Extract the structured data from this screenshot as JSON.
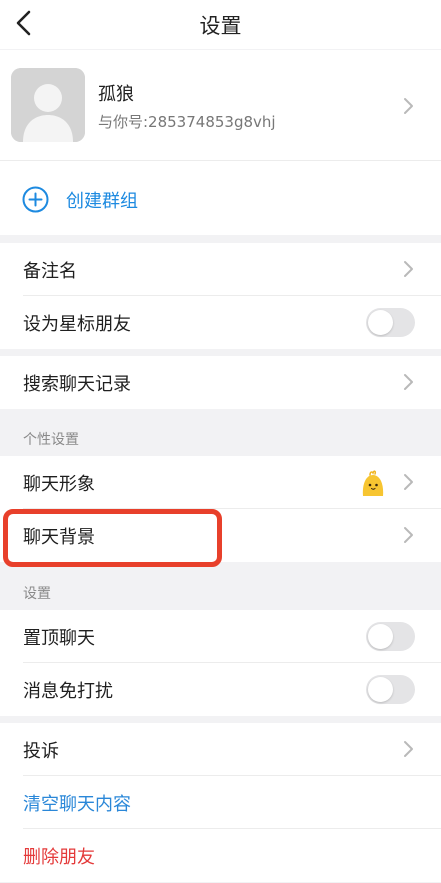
{
  "header": {
    "title": "设置",
    "back_icon": "chevron-left-icon"
  },
  "profile": {
    "name": "孤狼",
    "id_text": "与你号:285374853g8vhj"
  },
  "create_group": {
    "label": "创建群组",
    "icon": "plus-circle-icon"
  },
  "rows": {
    "remark": "备注名",
    "star_friend": "设为星标朋友",
    "search_history": "搜索聊天记录",
    "chat_avatar": "聊天形象",
    "chat_background": "聊天背景",
    "pin_chat": "置顶聊天",
    "do_not_disturb": "消息免打扰",
    "report": "投诉",
    "clear_chat": "清空聊天内容",
    "delete_friend": "删除朋友"
  },
  "sections": {
    "personal": "个性设置",
    "settings": "设置"
  },
  "toggles": {
    "star_friend": false,
    "pin_chat": false,
    "do_not_disturb": false
  },
  "colors": {
    "accent_blue": "#1d8ae0",
    "danger_red": "#e43a3a",
    "highlight": "#e8402b"
  }
}
